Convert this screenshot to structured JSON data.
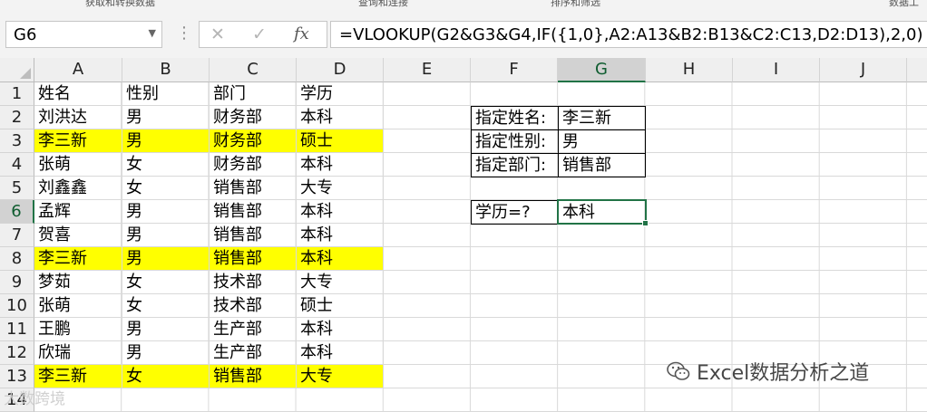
{
  "toolbar_strip": [
    "获取和转换数据",
    "查询和连接",
    "排序和筛选",
    "数据工"
  ],
  "name_box": {
    "value": "G6",
    "dropdown_icon": "chevron-down-icon"
  },
  "formula_bar": {
    "cancel_icon": "close-icon",
    "enter_icon": "check-icon",
    "fx_label": "fx",
    "formula": "=VLOOKUP(G2&G3&G4,IF({1,0},A2:A13&B2:B13&C2:C13,D2:D13),2,0)"
  },
  "columns": [
    "A",
    "B",
    "C",
    "D",
    "E",
    "F",
    "G",
    "H",
    "I",
    "J"
  ],
  "selected_column": "G",
  "selected_row": "6",
  "rows": [
    "1",
    "2",
    "3",
    "4",
    "5",
    "6",
    "7",
    "8",
    "9",
    "10",
    "11",
    "12",
    "13",
    "14"
  ],
  "table": {
    "headers": [
      "姓名",
      "性别",
      "部门",
      "学历"
    ],
    "data": [
      [
        "刘洪达",
        "男",
        "财务部",
        "本科"
      ],
      [
        "李三新",
        "男",
        "财务部",
        "硕士"
      ],
      [
        "张萌",
        "女",
        "财务部",
        "本科"
      ],
      [
        "刘鑫鑫",
        "女",
        "销售部",
        "大专"
      ],
      [
        "孟辉",
        "男",
        "销售部",
        "本科"
      ],
      [
        "贺喜",
        "男",
        "销售部",
        "本科"
      ],
      [
        "李三新",
        "男",
        "销售部",
        "本科"
      ],
      [
        "梦茹",
        "女",
        "技术部",
        "大专"
      ],
      [
        "张萌",
        "女",
        "技术部",
        "硕士"
      ],
      [
        "王鹏",
        "男",
        "生产部",
        "本科"
      ],
      [
        "欣瑞",
        "男",
        "生产部",
        "本科"
      ],
      [
        "李三新",
        "女",
        "销售部",
        "大专"
      ]
    ],
    "highlight_color": "#ffff00"
  },
  "lookup": {
    "name_label": "指定姓名:",
    "name_value": "李三新",
    "gender_label": "指定性别:",
    "gender_value": "男",
    "dept_label": "指定部门:",
    "dept_value": "销售部",
    "result_label": "学历=?",
    "result_value": "本科"
  },
  "watermark": {
    "text": "Excel数据分析之道",
    "icon": "wechat-icon",
    "corner_text": "大数跨境"
  },
  "accent_color": "#217346"
}
